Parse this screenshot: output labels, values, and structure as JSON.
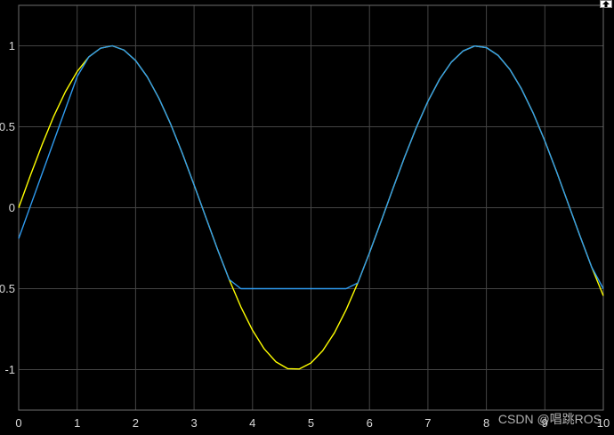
{
  "chart_data": {
    "type": "line",
    "title": "",
    "xlabel": "",
    "ylabel": "",
    "xlim": [
      0,
      10
    ],
    "ylim": [
      -1.25,
      1.25
    ],
    "x_ticks": [
      0,
      1,
      2,
      3,
      4,
      5,
      6,
      7,
      8,
      9,
      10
    ],
    "y_ticks": [
      -1,
      -0.5,
      0,
      0.5,
      1
    ],
    "x_tick_labels": [
      "0",
      "1",
      "2",
      "3",
      "4",
      "5",
      "6",
      "7",
      "8",
      "9",
      "10"
    ],
    "y_tick_labels": [
      "-1",
      "-0.5",
      "0",
      "0.5",
      "1"
    ],
    "grid": true,
    "background": "#000000",
    "grid_color": "#444444",
    "series": [
      {
        "color": "#FFFF00",
        "x": [
          0,
          0.2,
          0.4,
          0.6,
          0.8,
          1.0,
          1.2,
          1.4,
          1.6,
          1.8,
          2.0,
          2.2,
          2.4,
          2.6,
          2.8,
          3.0,
          3.2,
          3.4,
          3.6,
          3.8,
          4.0,
          4.2,
          4.4,
          4.6,
          4.8,
          5.0,
          5.2,
          5.4,
          5.6,
          5.8,
          6.0,
          6.2,
          6.4,
          6.6,
          6.8,
          7.0,
          7.2,
          7.4,
          7.6,
          7.8,
          8.0,
          8.2,
          8.4,
          8.6,
          8.8,
          9.0,
          9.2,
          9.4,
          9.6,
          9.8,
          10.0
        ],
        "y": [
          0,
          0.199,
          0.389,
          0.565,
          0.717,
          0.841,
          0.932,
          0.985,
          1.0,
          0.974,
          0.909,
          0.808,
          0.675,
          0.516,
          0.335,
          0.141,
          -0.058,
          -0.256,
          -0.443,
          -0.612,
          -0.757,
          -0.872,
          -0.952,
          -0.994,
          -0.996,
          -0.959,
          -0.883,
          -0.773,
          -0.631,
          -0.465,
          -0.279,
          -0.083,
          0.117,
          0.312,
          0.494,
          0.657,
          0.794,
          0.899,
          0.968,
          0.999,
          0.989,
          0.941,
          0.855,
          0.734,
          0.585,
          0.412,
          0.223,
          0.025,
          -0.174,
          -0.366,
          -0.544
        ]
      },
      {
        "color": "#2F9BF0",
        "x": [
          0,
          0.2,
          0.4,
          0.6,
          0.8,
          1.0,
          1.2,
          1.4,
          1.6,
          1.8,
          2.0,
          2.2,
          2.4,
          2.6,
          2.8,
          3.0,
          3.2,
          3.4,
          3.6,
          3.8,
          4.0,
          4.2,
          4.4,
          4.6,
          4.8,
          5.0,
          5.2,
          5.4,
          5.6,
          5.8,
          6.0,
          6.2,
          6.4,
          6.6,
          6.8,
          7.0,
          7.2,
          7.4,
          7.6,
          7.8,
          8.0,
          8.2,
          8.4,
          8.6,
          8.8,
          9.0,
          9.2,
          9.4,
          9.6,
          9.8,
          10.0
        ],
        "y": [
          -0.19,
          0.01,
          0.21,
          0.41,
          0.61,
          0.81,
          0.932,
          0.985,
          1.0,
          0.974,
          0.909,
          0.808,
          0.675,
          0.516,
          0.335,
          0.141,
          -0.058,
          -0.256,
          -0.443,
          -0.5,
          -0.5,
          -0.5,
          -0.5,
          -0.5,
          -0.5,
          -0.5,
          -0.5,
          -0.5,
          -0.5,
          -0.465,
          -0.279,
          -0.083,
          0.117,
          0.312,
          0.494,
          0.657,
          0.794,
          0.899,
          0.968,
          0.999,
          0.989,
          0.941,
          0.855,
          0.734,
          0.585,
          0.412,
          0.223,
          0.025,
          -0.174,
          -0.366,
          -0.5
        ]
      }
    ]
  },
  "watermark": "CSDN @唱跳ROS"
}
